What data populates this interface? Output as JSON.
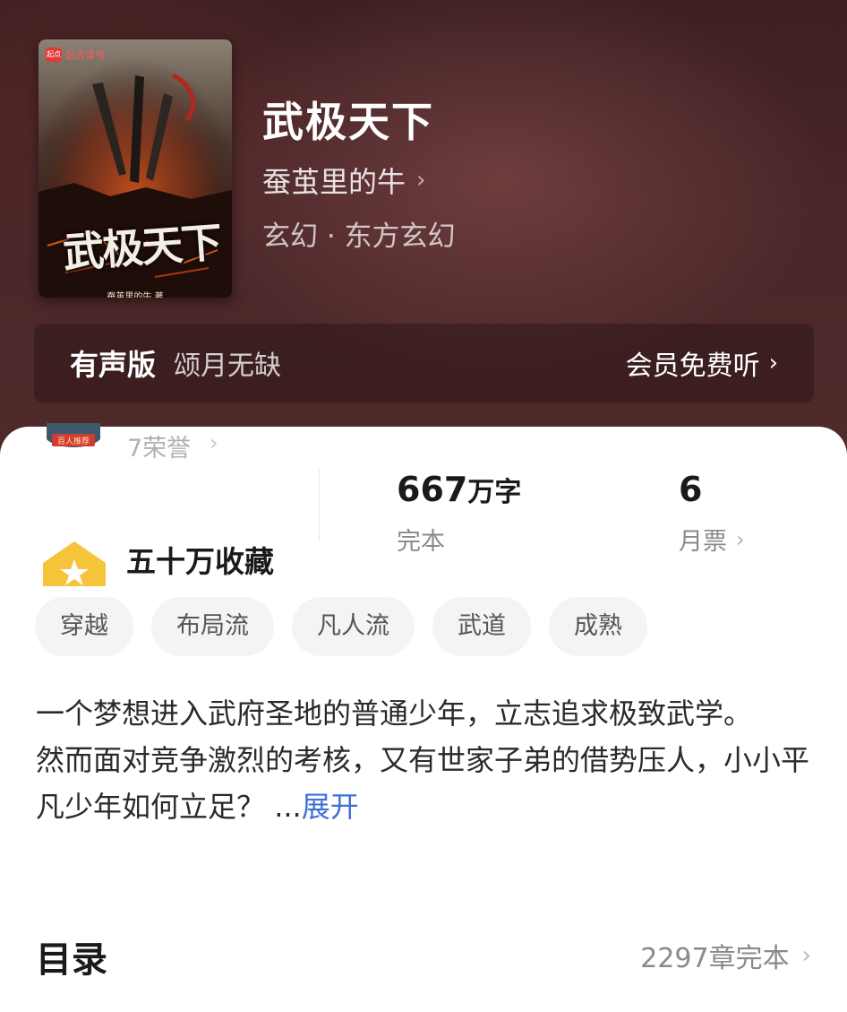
{
  "book": {
    "cover": {
      "brand": "起点读书",
      "brand_mark": "起点",
      "title": "武极天下",
      "author": "蚕茧里的牛 著"
    },
    "title": "武极天下",
    "author": "蚕茧里的牛",
    "genre": "玄幻 · 东方玄幻"
  },
  "audio": {
    "label": "有声版",
    "subtitle": "颂月无缺",
    "action": "会员免费听"
  },
  "honor": {
    "badge_text": "百人推荐",
    "text": "7荣誉"
  },
  "stats": {
    "words_number": "667",
    "words_unit": "万字",
    "words_label": "完本",
    "tickets_number": "6",
    "tickets_label": "月票"
  },
  "collection": {
    "text": "五十万收藏",
    "icon_color": "#f5c43a"
  },
  "tags": [
    "穿越",
    "布局流",
    "凡人流",
    "武道",
    "成熟"
  ],
  "intro": {
    "line1": "一个梦想进入武府圣地的普通少年，立志追求极致武学。",
    "line2": "然而面对竞争激烈的考核，又有世家子弟的借势压人，小小平凡少年如何立足？",
    "ellipsis": "...",
    "expand": "展开"
  },
  "toc": {
    "title": "目录",
    "meta": "2297章完本"
  },
  "colors": {
    "header_bg": "#4a2628",
    "link": "#3f6fd6",
    "tag_bg": "#f4f4f4"
  }
}
